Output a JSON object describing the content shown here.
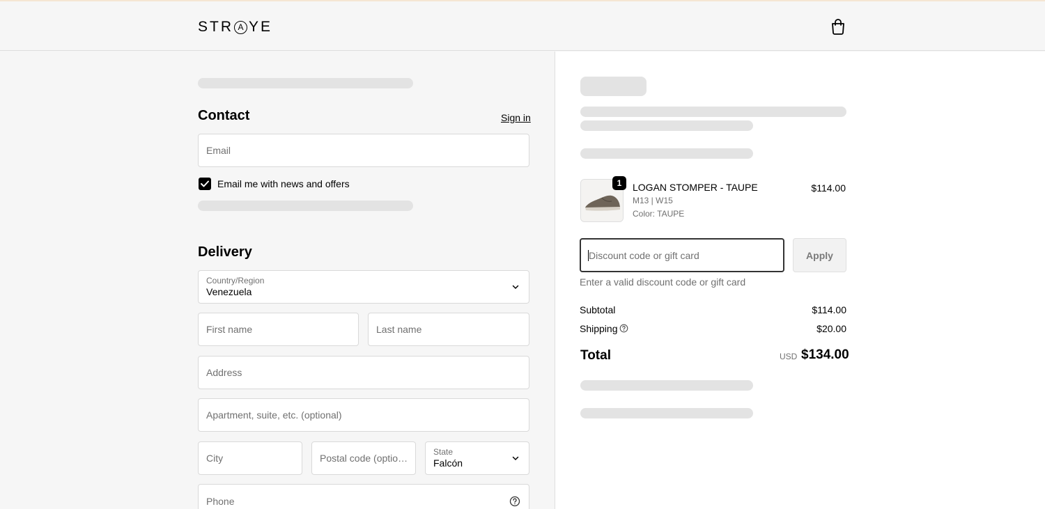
{
  "header": {
    "logo_text": "STRAYE",
    "logo_parts": {
      "before": "STR",
      "circled": "A",
      "after": "YE"
    },
    "cart_icon": "shopping-bag-icon"
  },
  "contact": {
    "title": "Contact",
    "sign_in": "Sign in",
    "email_placeholder": "Email",
    "newsletter_label": "Email me with news and offers",
    "newsletter_checked": true
  },
  "delivery": {
    "title": "Delivery",
    "country_label": "Country/Region",
    "country_value": "Venezuela",
    "first_name_placeholder": "First name",
    "last_name_placeholder": "Last name",
    "address_placeholder": "Address",
    "apartment_placeholder": "Apartment, suite, etc. (optional)",
    "city_placeholder": "City",
    "postal_placeholder": "Postal code (option…",
    "state_label": "State",
    "state_value": "Falcón",
    "phone_placeholder": "Phone"
  },
  "summary": {
    "product": {
      "quantity": "1",
      "name": "LOGAN STOMPER - TAUPE",
      "size": "M13 | W15",
      "color": "Color: TAUPE",
      "price": "$114.00"
    },
    "discount_placeholder": "Discount code or gift card",
    "apply_label": "Apply",
    "discount_error": "Enter a valid discount code or gift card",
    "subtotal_label": "Subtotal",
    "subtotal_value": "$114.00",
    "shipping_label": "Shipping",
    "shipping_value": "$20.00",
    "total_label": "Total",
    "total_currency": "USD",
    "total_value": "$134.00"
  },
  "colors": {
    "accent": "#000000",
    "background_left": "#f6f6f6",
    "background_right": "#ffffff",
    "skeleton": "#e3e3e3"
  }
}
